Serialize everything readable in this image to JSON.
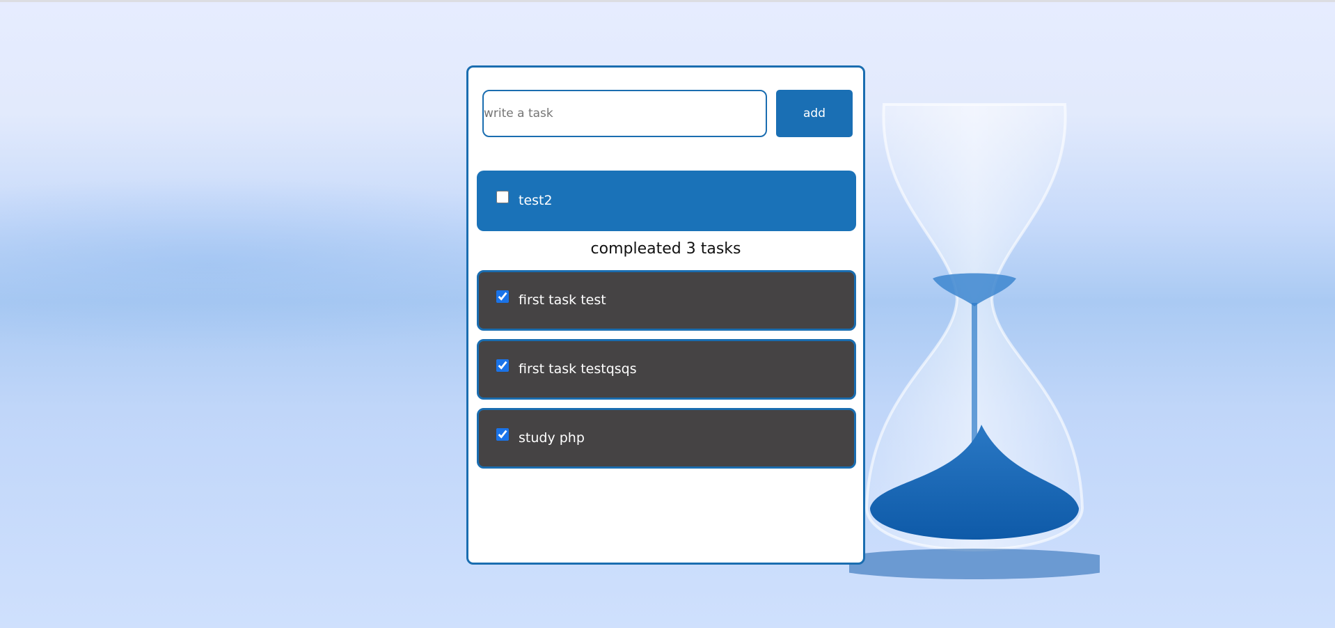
{
  "form": {
    "input_placeholder": "write a task",
    "input_value": "",
    "add_label": "add"
  },
  "pending_tasks": [
    {
      "label": "test2",
      "checked": false
    }
  ],
  "completed": {
    "heading": "compleated 3 tasks",
    "tasks": [
      {
        "label": "first task test",
        "checked": true
      },
      {
        "label": "first task testqsqs",
        "checked": true
      },
      {
        "label": "study php",
        "checked": true
      }
    ]
  },
  "colors": {
    "accent": "#1a6fb4",
    "done_item_bg": "#454344",
    "card_bg": "#ffffff"
  },
  "icons": {
    "background": "hourglass-icon"
  }
}
